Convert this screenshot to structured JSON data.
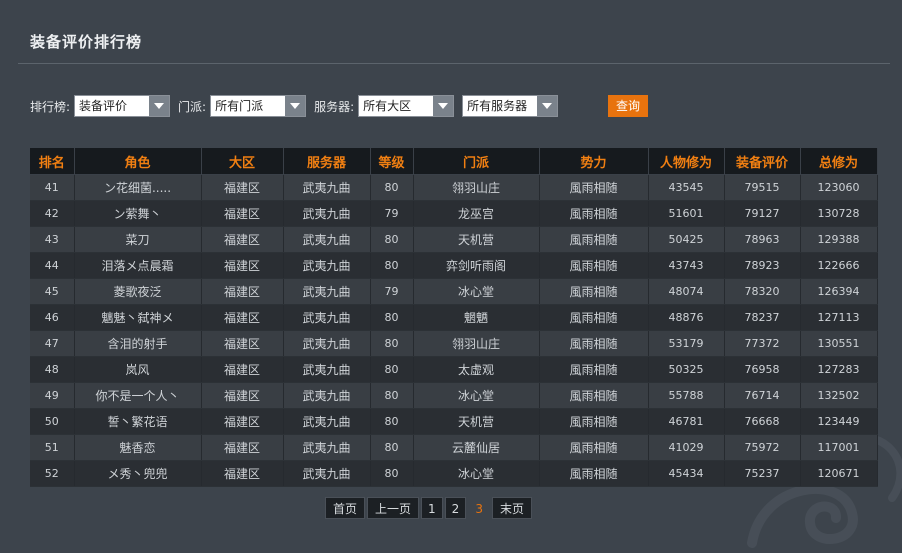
{
  "page": {
    "title": "装备评价排行榜"
  },
  "filters": {
    "rank_label": "排行榜:",
    "rank_value": "装备评价",
    "school_label": "门派:",
    "school_value": "所有门派",
    "server_label": "服务器:",
    "region_value": "所有大区",
    "server_value": "所有服务器",
    "query_label": "查询"
  },
  "table": {
    "headers": [
      "排名",
      "角色",
      "大区",
      "服务器",
      "等级",
      "门派",
      "势力",
      "人物修为",
      "装备评价",
      "总修为"
    ],
    "rows": [
      [
        "41",
        "ン花细菌.....",
        "福建区",
        "武夷九曲",
        "80",
        "翎羽山庄",
        "風雨相随",
        "43545",
        "79515",
        "123060"
      ],
      [
        "42",
        "ン萦舞丶",
        "福建区",
        "武夷九曲",
        "79",
        "龙巫宫",
        "風雨相随",
        "51601",
        "79127",
        "130728"
      ],
      [
        "43",
        "菜刀",
        "福建区",
        "武夷九曲",
        "80",
        "天机营",
        "風雨相随",
        "50425",
        "78963",
        "129388"
      ],
      [
        "44",
        "泪落メ点晨霜",
        "福建区",
        "武夷九曲",
        "80",
        "弈剑听雨阁",
        "風雨相随",
        "43743",
        "78923",
        "122666"
      ],
      [
        "45",
        "菱歌夜泛",
        "福建区",
        "武夷九曲",
        "79",
        "冰心堂",
        "風雨相随",
        "48074",
        "78320",
        "126394"
      ],
      [
        "46",
        "魑魅丶弑神メ",
        "福建区",
        "武夷九曲",
        "80",
        "魍魉",
        "風雨相随",
        "48876",
        "78237",
        "127113"
      ],
      [
        "47",
        "含泪的射手",
        "福建区",
        "武夷九曲",
        "80",
        "翎羽山庄",
        "風雨相随",
        "53179",
        "77372",
        "130551"
      ],
      [
        "48",
        "岚风",
        "福建区",
        "武夷九曲",
        "80",
        "太虚观",
        "風雨相随",
        "50325",
        "76958",
        "127283"
      ],
      [
        "49",
        "你不是一个人丶",
        "福建区",
        "武夷九曲",
        "80",
        "冰心堂",
        "風雨相随",
        "55788",
        "76714",
        "132502"
      ],
      [
        "50",
        "誓丶繁花语",
        "福建区",
        "武夷九曲",
        "80",
        "天机营",
        "風雨相随",
        "46781",
        "76668",
        "123449"
      ],
      [
        "51",
        "魅香恋",
        "福建区",
        "武夷九曲",
        "80",
        "云麓仙居",
        "風雨相随",
        "41029",
        "75972",
        "117001"
      ],
      [
        "52",
        "メ秀丶兜兜",
        "福建区",
        "武夷九曲",
        "80",
        "冰心堂",
        "風雨相随",
        "45434",
        "75237",
        "120671"
      ]
    ]
  },
  "pagination": {
    "first": "首页",
    "prev": "上一页",
    "pages": [
      "1",
      "2",
      "3"
    ],
    "current": "3",
    "last": "末页"
  },
  "colors": {
    "accent": "#e8730e",
    "header_text": "#f07f12",
    "background": "#3d444c"
  }
}
